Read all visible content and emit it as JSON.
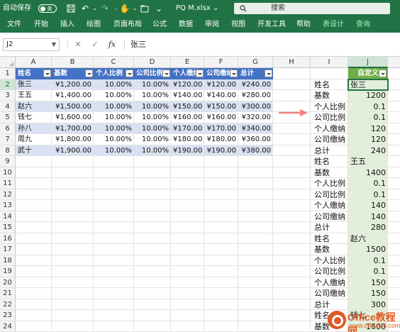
{
  "titlebar": {
    "autosave_label": "自动保存",
    "autosave_state": "关",
    "filename": "PQ M.xlsx",
    "filename_caret": "⌄",
    "search_placeholder": "搜索",
    "icons": [
      "save-icon",
      "undo-icon",
      "redo-icon",
      "touch-mode-icon",
      "folder-icon",
      "customize-icon"
    ]
  },
  "tabs": [
    "文件",
    "开始",
    "插入",
    "绘图",
    "页面布局",
    "公式",
    "数据",
    "审阅",
    "视图",
    "开发工具",
    "帮助",
    "表设计",
    "查询"
  ],
  "formula_bar": {
    "name_box": "J2",
    "cancel": "✕",
    "enter": "✓",
    "fx": "fx",
    "content": "张三"
  },
  "grid": {
    "columns": [
      "A",
      "B",
      "C",
      "D",
      "E",
      "F",
      "G",
      "H",
      "I",
      "J"
    ],
    "selected_column": "J",
    "rows": [
      "1",
      "2",
      "3",
      "4",
      "5",
      "6",
      "7",
      "8",
      "9",
      "10",
      "11",
      "12",
      "13",
      "14",
      "15",
      "16",
      "17",
      "18",
      "19",
      "20",
      "21",
      "22",
      "23",
      "24"
    ],
    "selected_row": "2"
  },
  "table": {
    "headers": [
      "姓名",
      "基数",
      "个人比例",
      "公司比例",
      "个人缴纳",
      "公司缴纳",
      "总计"
    ],
    "rows": [
      [
        "张三",
        "¥1,200.00",
        "10.00%",
        "10.00%",
        "¥120.00",
        "¥120.00",
        "¥240.00"
      ],
      [
        "王五",
        "¥1,400.00",
        "10.00%",
        "10.00%",
        "¥140.00",
        "¥140.00",
        "¥280.00"
      ],
      [
        "赵六",
        "¥1,500.00",
        "10.00%",
        "10.00%",
        "¥150.00",
        "¥150.00",
        "¥300.00"
      ],
      [
        "钱七",
        "¥1,600.00",
        "10.00%",
        "10.00%",
        "¥160.00",
        "¥160.00",
        "¥320.00"
      ],
      [
        "孙八",
        "¥1,700.00",
        "10.00%",
        "10.00%",
        "¥170.00",
        "¥170.00",
        "¥340.00"
      ],
      [
        "周九",
        "¥1,800.00",
        "10.00%",
        "10.00%",
        "¥180.00",
        "¥180.00",
        "¥360.00"
      ],
      [
        "武十",
        "¥1,900.00",
        "10.00%",
        "10.00%",
        "¥190.00",
        "¥190.00",
        "¥380.00"
      ]
    ]
  },
  "custom_column": {
    "header": "自定义",
    "i_labels": [
      "姓名",
      "基数",
      "个人比例",
      "公司比例",
      "个人缴纳",
      "公司缴纳",
      "总计",
      "姓名",
      "基数",
      "个人比例",
      "公司比例",
      "个人缴纳",
      "公司缴纳",
      "总计",
      "姓名",
      "基数",
      "个人比例",
      "公司比例",
      "个人缴纳",
      "公司缴纳",
      "总计",
      "姓名",
      "基数"
    ],
    "j_values": [
      "张三",
      "1200",
      "0.1",
      "0.1",
      "120",
      "120",
      "240",
      "王五",
      "1400",
      "0.1",
      "0.1",
      "140",
      "140",
      "280",
      "赵六",
      "1500",
      "0.1",
      "0.1",
      "150",
      "150",
      "300",
      "钱七",
      "1600"
    ]
  },
  "watermark": {
    "brand": "Office教程网",
    "url": "www.office26.com"
  }
}
